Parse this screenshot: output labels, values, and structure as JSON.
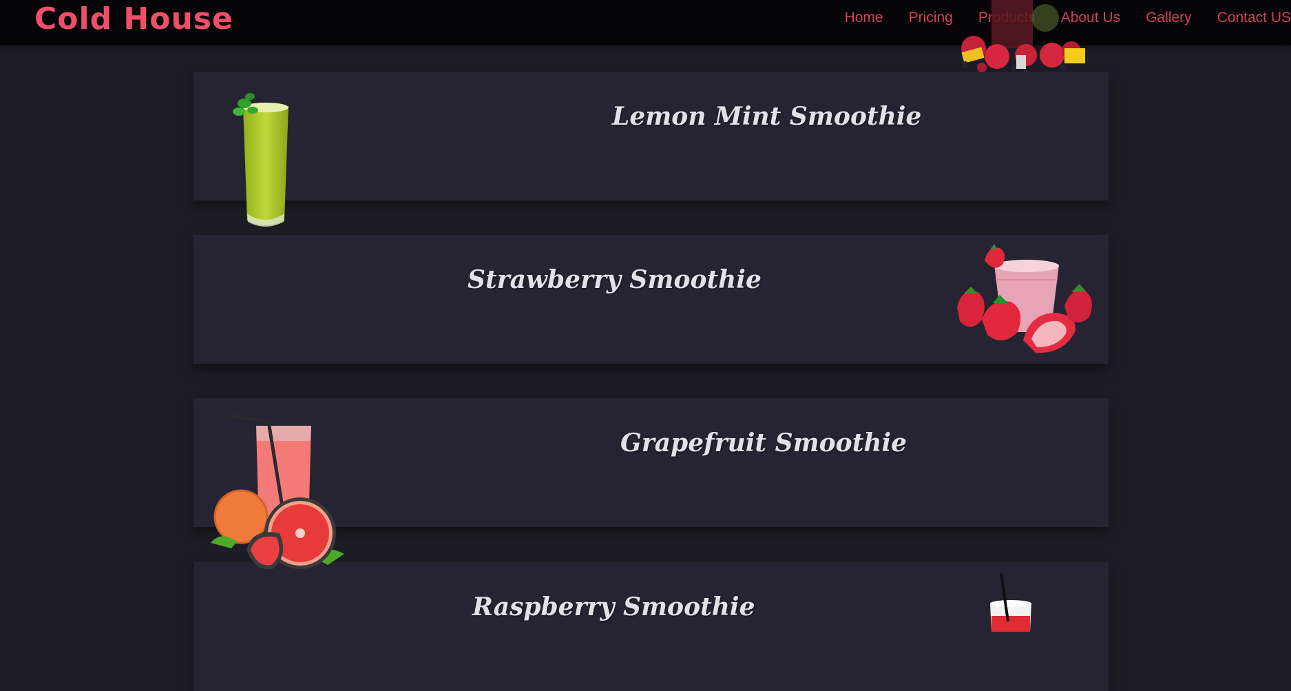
{
  "brand": "Cold House",
  "nav": [
    "Home",
    "Pricing",
    "Products",
    "About Us",
    "Gallery",
    "Contact US"
  ],
  "products": [
    {
      "name": "Lemon Mint Smoothie"
    },
    {
      "name": "Strawberry Smoothie"
    },
    {
      "name": "Grapefruit Smoothie"
    },
    {
      "name": "Raspberry Smoothie"
    }
  ],
  "colors": {
    "brand": "#ef4e6a",
    "nav_link": "#d44058",
    "background": "#1e1d27",
    "card": "#262332",
    "navbar": "#050508"
  }
}
